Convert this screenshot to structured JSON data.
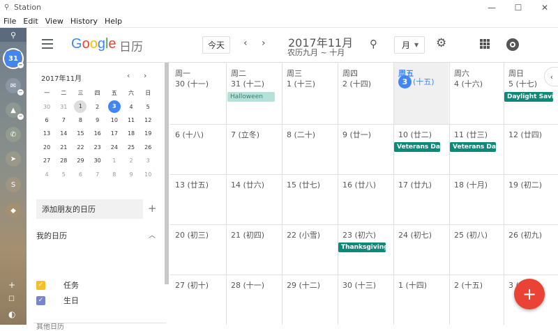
{
  "window": {
    "title": "Station",
    "minimize": "—",
    "maximize": "☐",
    "close": "✕"
  },
  "menu": [
    "File",
    "Edit",
    "View",
    "History",
    "Help"
  ],
  "header": {
    "logo_google": "Google",
    "logo_sub": "日历",
    "today": "今天",
    "prev": "‹",
    "next": "›",
    "month": "2017年11月",
    "lunar": "农历九月 ~ 十月",
    "view": "月",
    "search_icon": "search-icon",
    "gear_icon": "gear-icon"
  },
  "mini_calendar": {
    "title": "2017年11月",
    "weekdays": [
      "一",
      "二",
      "三",
      "四",
      "五",
      "六",
      "日"
    ],
    "weeks": [
      [
        "30",
        "31",
        "1",
        "2",
        "3",
        "4",
        "5"
      ],
      [
        "6",
        "7",
        "8",
        "9",
        "10",
        "11",
        "12"
      ],
      [
        "13",
        "14",
        "15",
        "16",
        "17",
        "18",
        "19"
      ],
      [
        "20",
        "21",
        "22",
        "23",
        "24",
        "25",
        "26"
      ],
      [
        "27",
        "28",
        "29",
        "30",
        "1",
        "2",
        "3"
      ],
      [
        "4",
        "5",
        "6",
        "7",
        "8",
        "9",
        "10"
      ]
    ]
  },
  "sidebar": {
    "add_friend": "添加朋友的日历",
    "my_calendars": "我的日历",
    "calendars": [
      {
        "label": "任务",
        "color": "#f6bf26"
      },
      {
        "label": "生日",
        "color": "#7986cb"
      }
    ],
    "other": "其他日历"
  },
  "month_grid": {
    "weekdays": [
      "周一",
      "周二",
      "周三",
      "周四",
      "周五",
      "周六",
      "周日"
    ],
    "weeks": [
      [
        "30 (十一)",
        "31 (十二)",
        "1 (十三)",
        "2 (十四)",
        "(十五)",
        "4 (十六)",
        "5 (十七)"
      ],
      [
        "6 (十八)",
        "7 (立冬)",
        "8 (二十)",
        "9 (廿一)",
        "10 (廿二)",
        "11 (廿三)",
        "12 (廿四)"
      ],
      [
        "13 (廿五)",
        "14 (廿六)",
        "15 (廿七)",
        "16 (廿八)",
        "17 (廿九)",
        "18 (十月)",
        "19 (初二)"
      ],
      [
        "20 (初三)",
        "21 (初四)",
        "22 (小雪)",
        "23 (初六)",
        "24 (初七)",
        "25 (初八)",
        "26 (初九)"
      ],
      [
        "27 (初十)",
        "28 (十一)",
        "29 (十二)",
        "30 (十三)",
        "1 (十四)",
        "2 (十五)",
        "3 (十六)"
      ]
    ],
    "today_day": "3",
    "events": {
      "halloween": "Halloween",
      "daylight": "Daylight Saving Time ends",
      "veterans1": "Veterans Day (substitute)",
      "veterans2": "Veterans Day",
      "thanksgiving": "Thanksgiving"
    }
  },
  "fab": "+",
  "collapse": "‹",
  "colors": {
    "accent": "#4285f4",
    "event": "#0b8a7a",
    "fab": "#ea4335"
  }
}
